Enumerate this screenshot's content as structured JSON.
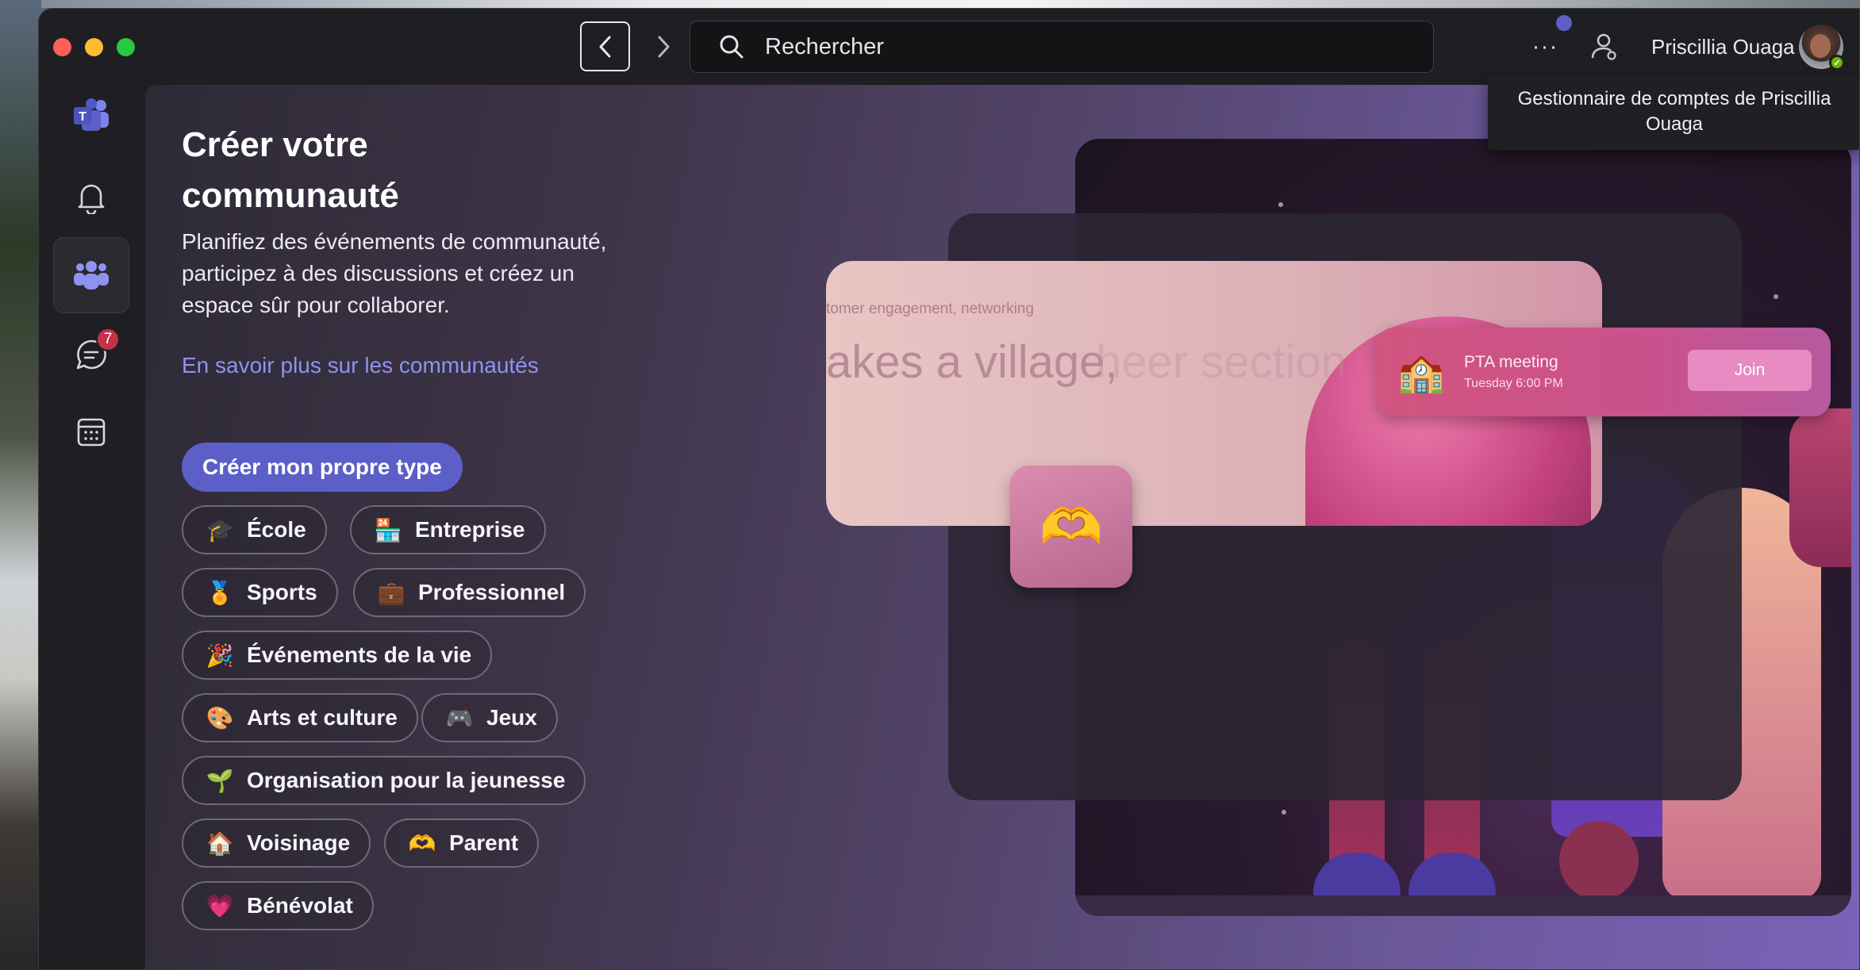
{
  "window": {
    "search_placeholder": "Rechercher",
    "more_label": "···",
    "user_name": "Priscillia Ouaga",
    "tooltip": "Gestionnaire de comptes de Priscillia Ouaga"
  },
  "rail": {
    "items": [
      {
        "name": "teams-logo",
        "icon": "teams-logo-icon"
      },
      {
        "name": "activity",
        "icon": "bell-icon"
      },
      {
        "name": "communities",
        "icon": "people-icon",
        "active": true
      },
      {
        "name": "chat",
        "icon": "chat-icon",
        "badge": "7"
      },
      {
        "name": "calendar",
        "icon": "calendar-icon"
      }
    ]
  },
  "main": {
    "title": "Créer votre communauté",
    "description": "Planifiez des événements de communauté, participez à des discussions et créez un espace sûr pour collaborer.",
    "learn_more": "En savoir plus sur les communautés",
    "create_button": "Créer mon propre type",
    "categories": [
      {
        "label": "École",
        "icon": "🎓"
      },
      {
        "label": "Entreprise",
        "icon": "🏪"
      },
      {
        "label": "Sports",
        "icon": "🏅"
      },
      {
        "label": "Professionnel",
        "icon": "💼"
      },
      {
        "label": "Événements de la vie",
        "icon": "🎉"
      },
      {
        "label": "Arts et culture",
        "icon": "🎨"
      },
      {
        "label": "Jeux",
        "icon": "🎮"
      },
      {
        "label": "Organisation pour la jeunesse",
        "icon": "🌱"
      },
      {
        "label": "Voisinage",
        "icon": "🏠"
      },
      {
        "label": "Parent",
        "icon": "🫶"
      },
      {
        "label": "Bénévolat",
        "icon": "💗"
      }
    ]
  },
  "illustration": {
    "tagline": "tomer engagement, networking",
    "headline": "akes a village,",
    "ghost_text": "heer section",
    "meeting_title": "PTA meeting",
    "meeting_time": "Tuesday 6:00 PM",
    "join_label": "Join"
  },
  "colors": {
    "accent": "#5b5fc7",
    "link": "#8f93f0",
    "badge": "#c4314b"
  }
}
